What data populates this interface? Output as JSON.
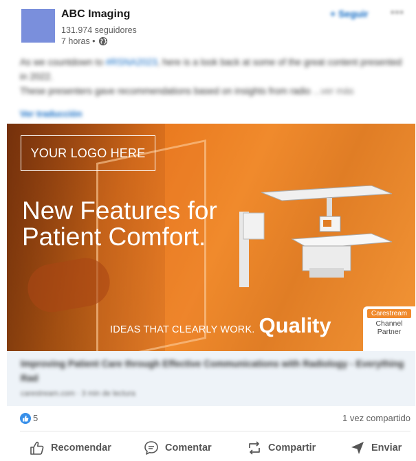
{
  "post": {
    "company_name": "ABC Imaging",
    "followers": "131.974 seguidores",
    "time": "7 horas •",
    "follow_label": "+ Seguir",
    "more_label": "•••",
    "text_line1_pre": "As we countdown to ",
    "text_hashtag": "#RSNA2023",
    "text_line1_post": ", here is a look back at some of the great content presented in 2022.",
    "text_line2": "These presenters gave recommendations based on insights from radio",
    "see_more": "...ver más",
    "translate_label": "Ver traducción"
  },
  "banner": {
    "logo_text": "YOUR LOGO HERE",
    "headline_line1": "New Features for",
    "headline_line2": "Patient Comfort.",
    "tagline_ideas": "IDEAS THAT CLEARLY WORK.",
    "tagline_quality": "Quality",
    "partner_brand": "Carestream",
    "partner_line1": "Channel",
    "partner_line2": "Partner"
  },
  "link_card": {
    "title": "Improving Patient Care through Effective Communications with Radiology - Everything Rad",
    "source": "carestream.com · 3 min de lectura"
  },
  "stats": {
    "likes": "5",
    "shares": "1 vez compartido"
  },
  "actions": {
    "recommend": "Recomendar",
    "comment": "Comentar",
    "share": "Compartir",
    "send": "Enviar"
  },
  "colors": {
    "accent": "#0a66c2",
    "avatar": "#7a8fdc",
    "banner_orange": "#f08a2c"
  }
}
